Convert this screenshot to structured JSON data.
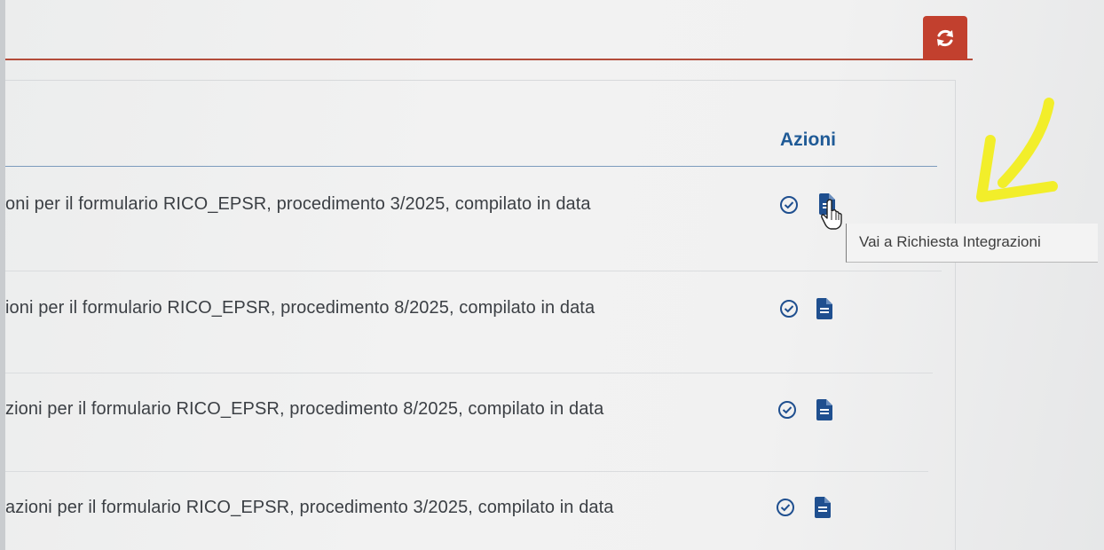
{
  "toolbar": {
    "refresh_icon": "refresh-icon",
    "accent_color": "#c2402e"
  },
  "table": {
    "header": {
      "actions_label": "Azioni"
    },
    "rows": [
      {
        "text": "oni per il formulario RICO_EPSR, procedimento 3/2025, compilato in data",
        "actions": [
          "check-circle-icon",
          "document-icon"
        ]
      },
      {
        "text": "ioni per il formulario RICO_EPSR, procedimento 8/2025, compilato in data",
        "actions": [
          "check-circle-icon",
          "document-icon"
        ]
      },
      {
        "text": "zioni per il formulario RICO_EPSR, procedimento 8/2025, compilato in data",
        "actions": [
          "check-circle-icon",
          "document-icon"
        ]
      },
      {
        "text": "azioni per il formulario RICO_EPSR, procedimento 3/2025, compilato in data",
        "actions": [
          "check-circle-icon",
          "document-icon"
        ]
      }
    ]
  },
  "tooltip": {
    "text": "Vai a Richiesta Integrazioni"
  },
  "colors": {
    "header_text": "#1f5a96",
    "icon_blue": "#1f4f8f",
    "annotation_yellow": "#f2ee2a"
  }
}
